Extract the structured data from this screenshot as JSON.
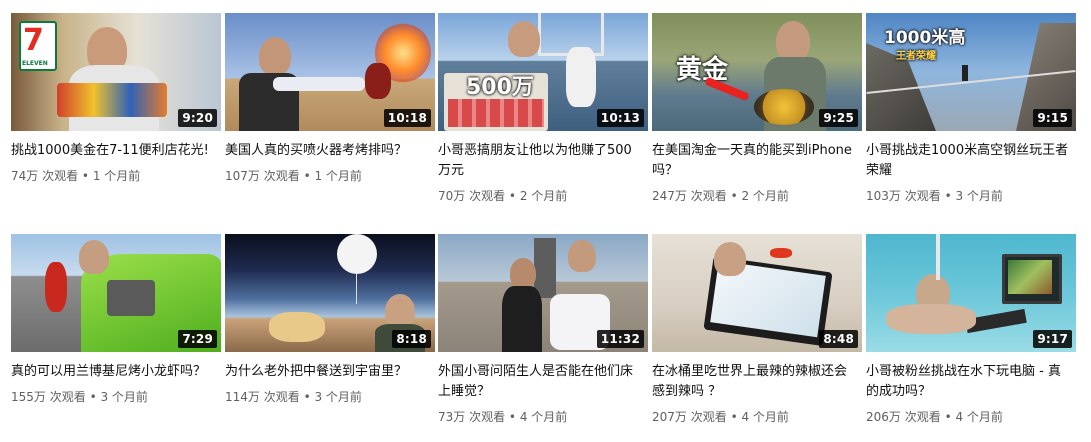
{
  "videos": [
    {
      "title": "挑战1000美金在7-11便利店花光!",
      "views": "74万 次观看",
      "age": "1 个月前",
      "duration": "9:20",
      "overlay": "",
      "logo_text": "ELEVEN"
    },
    {
      "title": "美国人真的买喷火器考烤排吗？",
      "views": "107万 次观看",
      "age": "1 个月前",
      "duration": "10:18",
      "overlay": ""
    },
    {
      "title": "小哥恶搞朋友让他以为他赚了500万元",
      "views": "70万 次观看",
      "age": "2 个月前",
      "duration": "10:13",
      "overlay": "500万"
    },
    {
      "title": "在美国淘金一天真的能买到iPhone吗？",
      "views": "247万 次观看",
      "age": "2 个月前",
      "duration": "9:25",
      "overlay": "黄金"
    },
    {
      "title": "小哥挑战走1000米高空钢丝玩王者荣耀",
      "views": "103万 次观看",
      "age": "3 个月前",
      "duration": "9:15",
      "overlay": "1000米高",
      "overlay_sub": "王者荣耀"
    },
    {
      "title": "真的可以用兰博基尼烤小龙虾吗？",
      "views": "155万 次观看",
      "age": "3 个月前",
      "duration": "7:29",
      "overlay": ""
    },
    {
      "title": "为什么老外把中餐送到宇宙里？",
      "views": "114万 次观看",
      "age": "3 个月前",
      "duration": "8:18",
      "overlay": ""
    },
    {
      "title": "外国小哥问陌生人是否能在他们床上睡觉？",
      "views": "73万 次观看",
      "age": "4 个月前",
      "duration": "11:32",
      "overlay": ""
    },
    {
      "title": "在冰桶里吃世界上最辣的辣椒还会感到辣吗 ？",
      "views": "207万 次观看",
      "age": "4 个月前",
      "duration": "8:48",
      "overlay": ""
    },
    {
      "title": "小哥被粉丝挑战在水下玩电脑 - 真的成功吗？",
      "views": "206万 次观看",
      "age": "4 个月前",
      "duration": "9:17",
      "overlay": ""
    }
  ],
  "separator": "•"
}
